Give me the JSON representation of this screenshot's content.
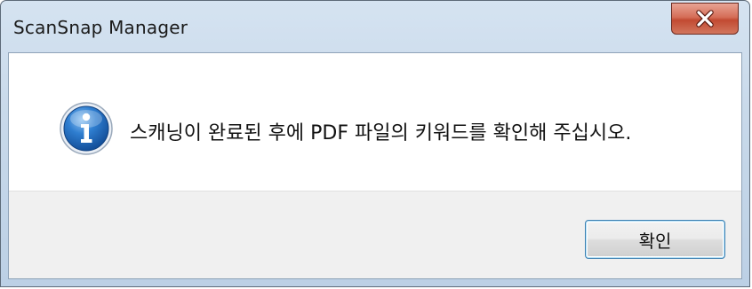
{
  "window": {
    "title": "ScanSnap Manager"
  },
  "dialog": {
    "icon": "info-icon",
    "message": "스캐닝이 완료된 후에 PDF 파일의 키워드를 확인해 주십시오.",
    "ok_label": "확인"
  },
  "colors": {
    "close_button": "#c9553d",
    "info_icon": "#2a6fc4",
    "ok_border": "#3c7fb1"
  }
}
